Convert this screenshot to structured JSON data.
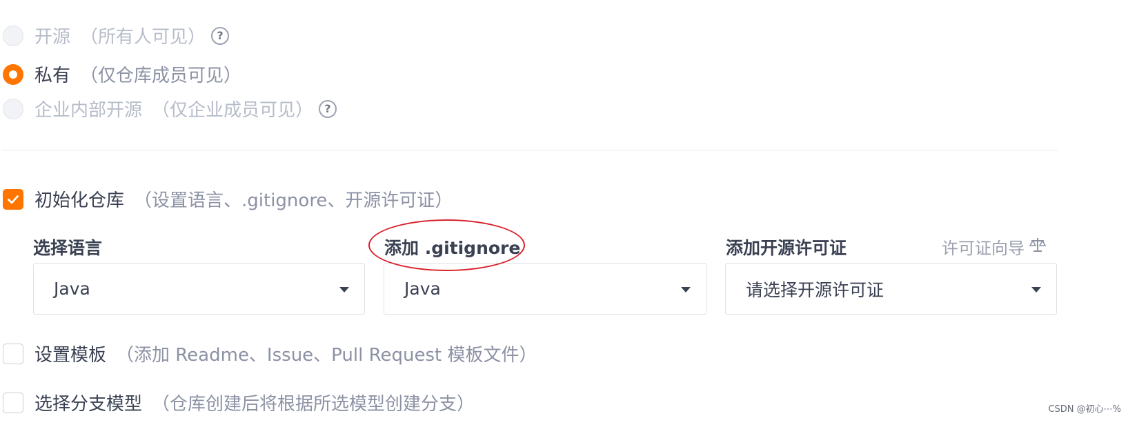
{
  "visibility": {
    "options": [
      {
        "label": "开源",
        "description": "（所有人可见）",
        "state": "disabled",
        "has_help": true
      },
      {
        "label": "私有",
        "description": "（仅仓库成员可见）",
        "state": "selected",
        "has_help": false
      },
      {
        "label": "企业内部开源",
        "description": "（仅企业成员可见）",
        "state": "disabled",
        "has_help": true
      }
    ],
    "help_icon_glyph": "?"
  },
  "init_repo": {
    "label": "初始化仓库",
    "description": "（设置语言、.gitignore、开源许可证）",
    "checked": true
  },
  "fields": {
    "language": {
      "label": "选择语言",
      "value": "Java"
    },
    "gitignore": {
      "label": "添加 .gitignore",
      "value": "Java"
    },
    "license": {
      "label": "添加开源许可证",
      "value": "请选择开源许可证",
      "wizard_label": "许可证向导",
      "wizard_icon": "scale-icon"
    }
  },
  "template": {
    "label": "设置模板",
    "description": "（添加 Readme、Issue、Pull Request 模板文件）",
    "checked": false
  },
  "branch_model": {
    "label": "选择分支模型",
    "description": "（仓库创建后将根据所选模型创建分支）",
    "checked": false
  },
  "watermark": "CSDN @初心⋯%",
  "colors": {
    "accent": "#ff7500",
    "annotation": "#d9202a"
  }
}
